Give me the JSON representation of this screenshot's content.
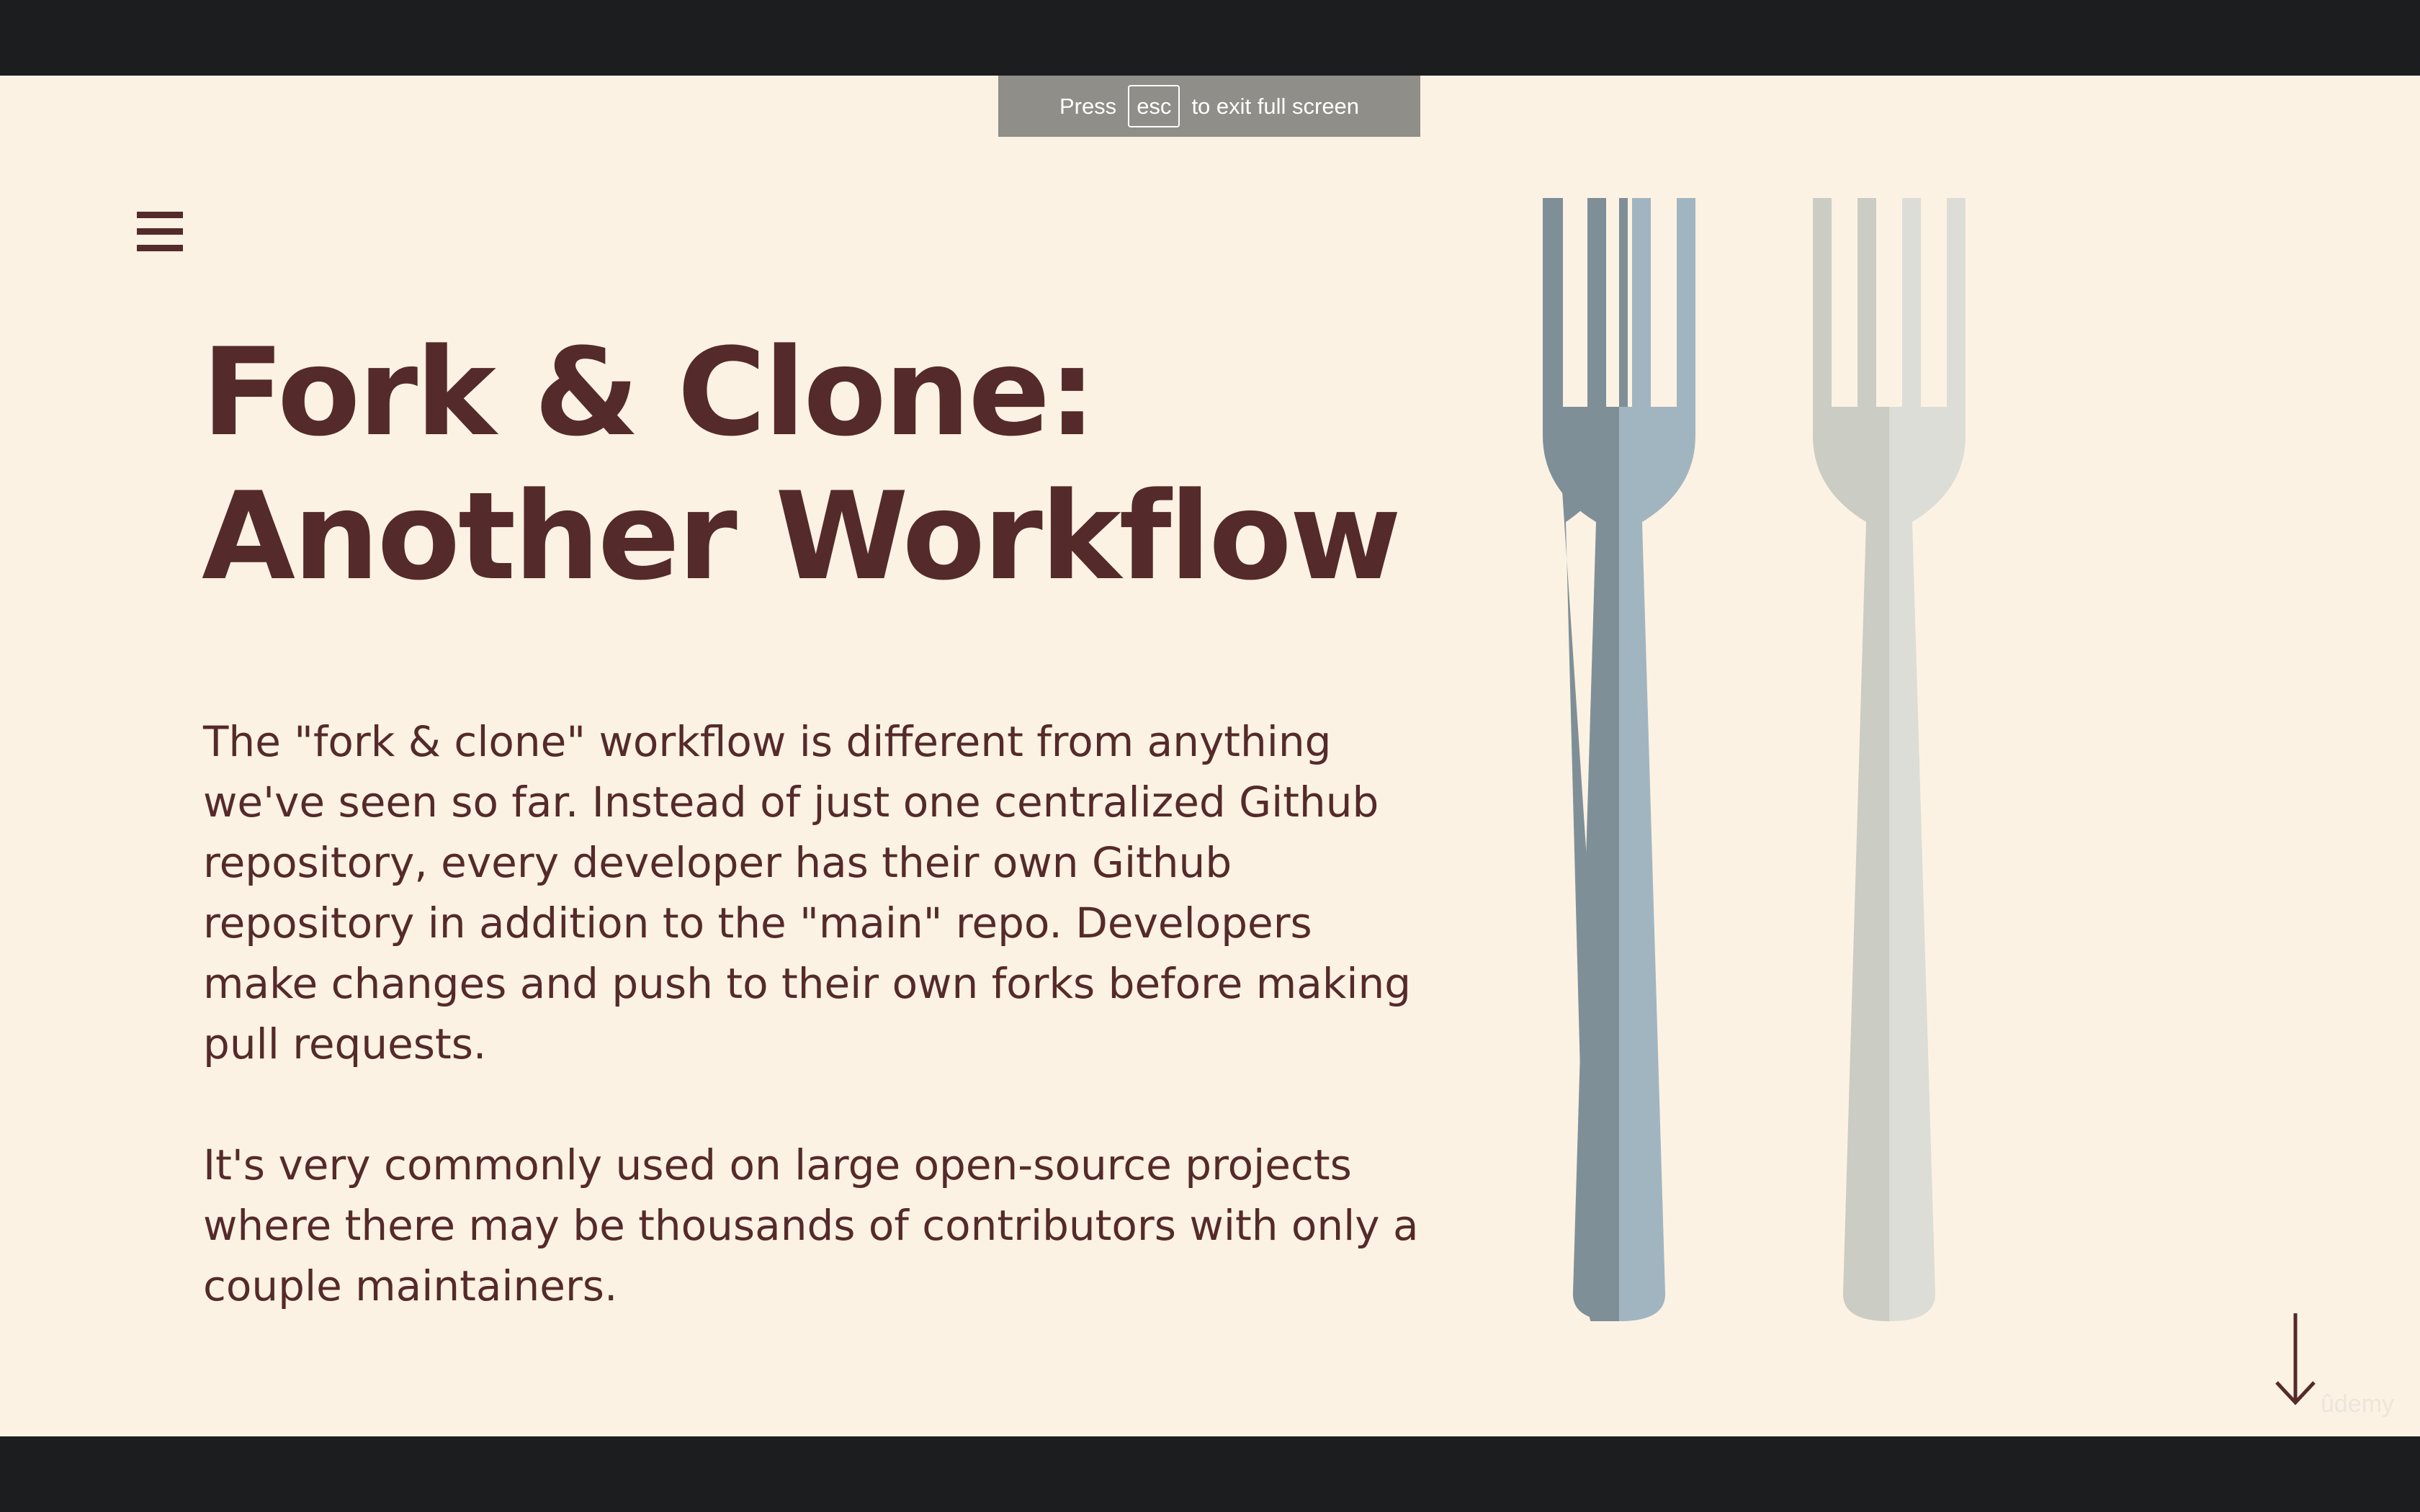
{
  "fullscreen_notice": {
    "prefix": "Press",
    "key": "esc",
    "suffix": "to exit full screen"
  },
  "slide": {
    "menu_icon": "hamburger-menu-icon",
    "title_lines": [
      "Fork & Clone:",
      "Another Workflow"
    ],
    "paragraph1_lines": [
      "The \"fork & clone\" workflow is different from anything",
      "we've seen so far.  Instead of just one centralized Github",
      "repository, every developer has their own Github",
      "repository in addition to the \"main\" repo.   Developers",
      "make changes and push to their own forks before making",
      "pull requests."
    ],
    "paragraph2_lines": [
      "It's very commonly used on large open-source projects",
      "where there may be thousands of contributors with only a",
      "couple maintainers."
    ],
    "illustration": "two-forks-icon",
    "next_icon": "down-arrow-icon",
    "watermark": "ûdemy"
  },
  "colors": {
    "slide_background": "#fcf2e3",
    "text": "#552a2a",
    "frame": "#1c1d1f",
    "fork_blue_dark": "#7f8f98",
    "fork_blue_light": "#a1b5c1",
    "fork_gray_dark": "#cbccc4",
    "fork_gray_light": "#dcddd6"
  }
}
